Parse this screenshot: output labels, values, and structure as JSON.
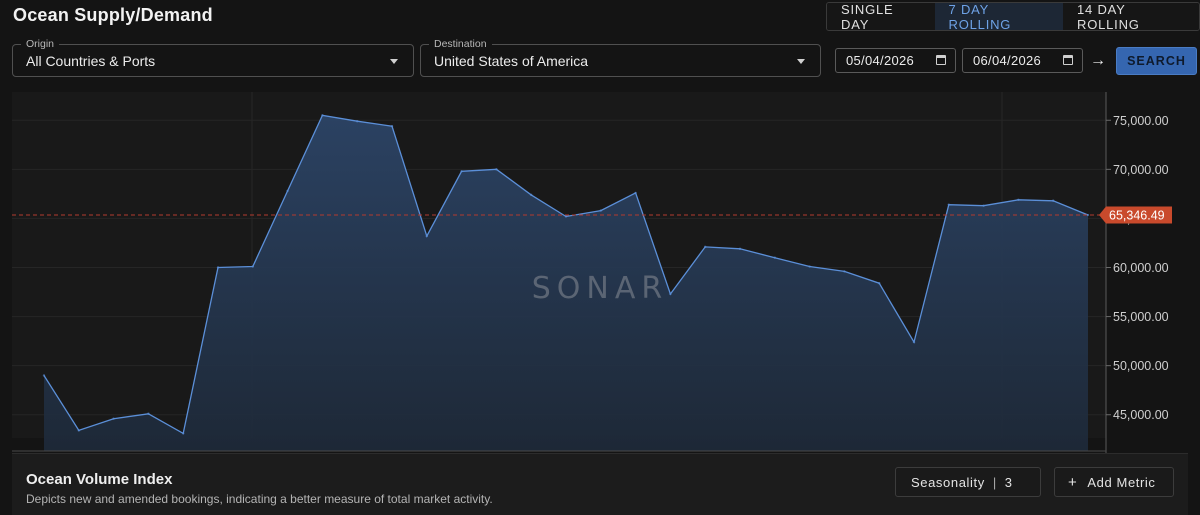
{
  "header": {
    "title": "Ocean Supply/Demand",
    "modes": [
      {
        "label": "SINGLE DAY",
        "active": false
      },
      {
        "label": "7 DAY ROLLING",
        "active": true
      },
      {
        "label": "14 DAY ROLLING",
        "active": false
      }
    ]
  },
  "filters": {
    "origin_label": "Origin",
    "origin_value": "All Countries & Ports",
    "destination_label": "Destination",
    "destination_value": "United States of America",
    "start_date": "05/04/2026",
    "end_date": "06/04/2026",
    "arrow": "→",
    "search_label": "SEARCH"
  },
  "colors": {
    "accent": "#3566b0",
    "line": "#5b8fd8",
    "area": "#2a3d58",
    "marker": "#c94a2c",
    "refline": "#b33a2e"
  },
  "chart_data": {
    "type": "area",
    "watermark": "SONAR",
    "y_ticks": [
      45000,
      50000,
      55000,
      60000,
      65000,
      70000,
      75000
    ],
    "y_tick_labels": [
      "45,000.00",
      "50,000.00",
      "55,000.00",
      "60,000.00",
      "65,000.00",
      "70,000.00",
      "75,000.00"
    ],
    "ylim": [
      41000,
      79000
    ],
    "last_value": 65346.49,
    "last_value_label": "65,346.49",
    "grid": true,
    "values": [
      49000,
      43400,
      44600,
      45100,
      43100,
      60000,
      60100,
      67800,
      75500,
      74900,
      74400,
      63200,
      69800,
      70000,
      67400,
      65200,
      65800,
      67600,
      57300,
      62100,
      61900,
      61000,
      60100,
      59600,
      58400,
      52400,
      66400,
      66300,
      66900,
      66800,
      65346.49
    ]
  },
  "metric": {
    "title": "Ocean Volume Index",
    "description": "Depicts new and amended bookings, indicating a better measure of total market activity.",
    "seasonality_label": "Seasonality",
    "seasonality_value": "3",
    "add_metric_label": "Add Metric",
    "add_icon": "+"
  }
}
